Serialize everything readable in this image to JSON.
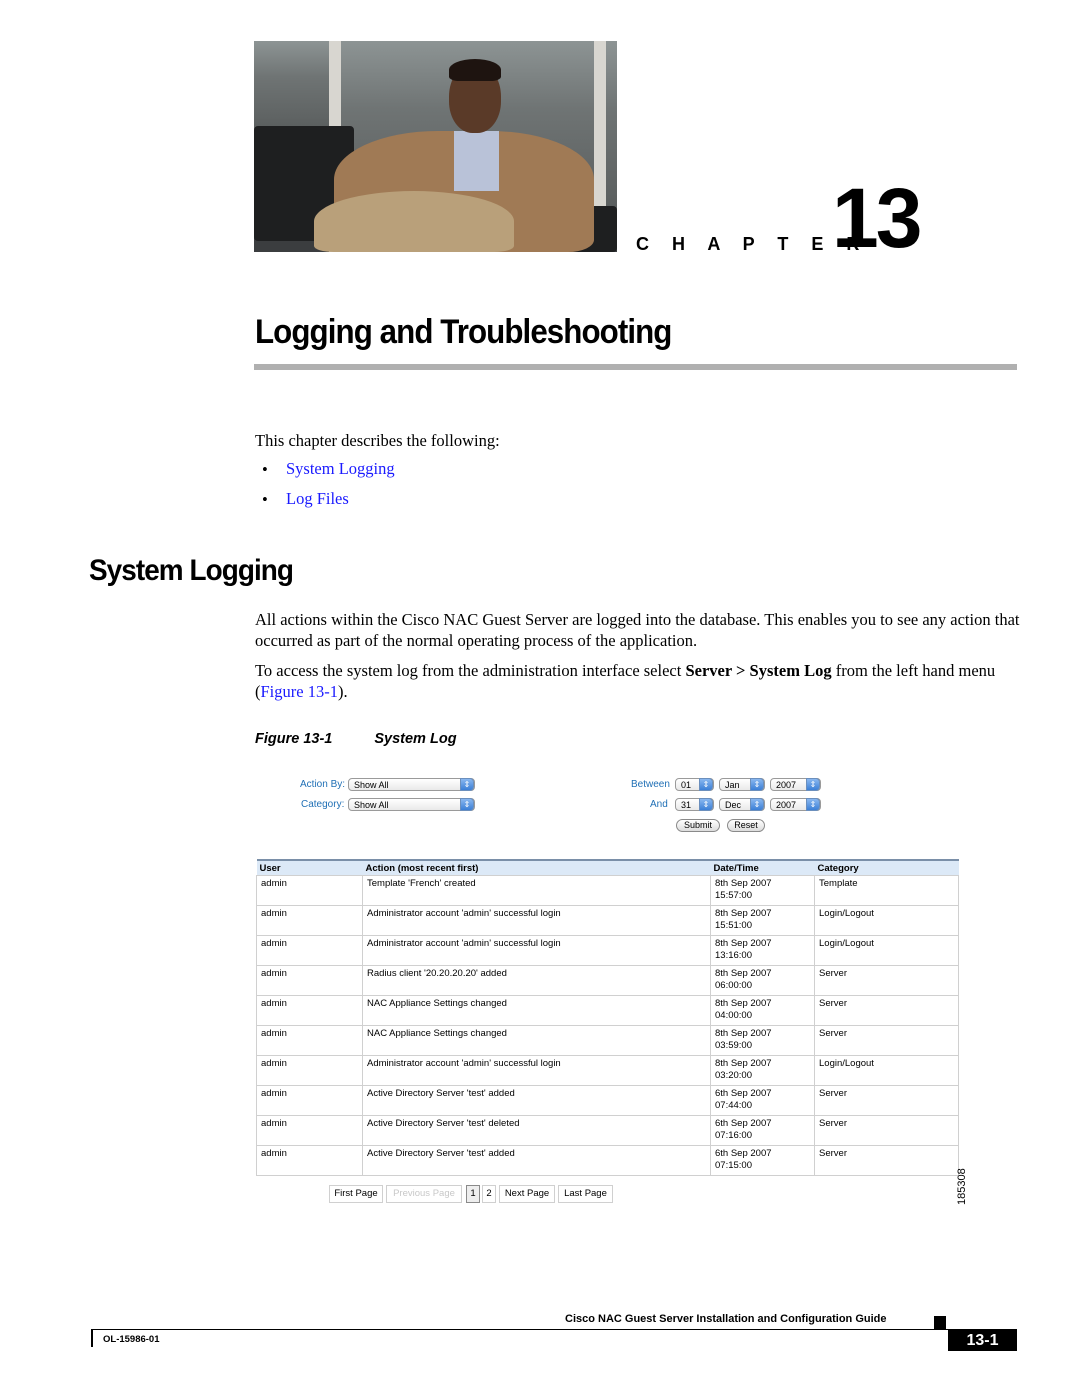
{
  "chapter": {
    "label": "C H A P T E R",
    "number": "13",
    "title": "Logging and Troubleshooting",
    "photo_alt": "man-seated-in-office"
  },
  "intro": {
    "text": "This chapter describes the following:",
    "bullets": [
      {
        "label": "System Logging"
      },
      {
        "label": "Log Files"
      }
    ],
    "bullet_glyph": "•"
  },
  "section": {
    "title": "System Logging",
    "para1": "All actions within the Cisco NAC Guest Server are logged into the database. This enables you to see any action that occurred as part of the normal operating process of the application.",
    "para2_pre": "To access the system log from the administration interface select ",
    "para2_bold": "Server > System Log",
    "para2_mid": " from the left hand menu (",
    "para2_link": "Figure 13-1",
    "para2_post": ")."
  },
  "figure": {
    "number": "Figure 13-1",
    "title": "System Log",
    "id": "185308",
    "filters": {
      "action_by_label": "Action By:",
      "action_by_value": "Show All",
      "category_label": "Category:",
      "category_value": "Show All",
      "between_label": "Between",
      "and_label": "And",
      "from_day": "01",
      "from_month": "Jan",
      "from_year": "2007",
      "to_day": "31",
      "to_month": "Dec",
      "to_year": "2007",
      "submit_label": "Submit",
      "reset_label": "Reset",
      "arrow_glyph": "⇕"
    },
    "table": {
      "headers": [
        "User",
        "Action (most recent first)",
        "Date/Time",
        "Category"
      ],
      "rows": [
        {
          "user": "admin",
          "action": "Template 'French' created",
          "date": "8th Sep 2007",
          "time": "15:57:00",
          "category": "Template"
        },
        {
          "user": "admin",
          "action": "Administrator account 'admin' successful login",
          "date": "8th Sep 2007",
          "time": "15:51:00",
          "category": "Login/Logout"
        },
        {
          "user": "admin",
          "action": "Administrator account 'admin' successful login",
          "date": "8th Sep 2007",
          "time": "13:16:00",
          "category": "Login/Logout"
        },
        {
          "user": "admin",
          "action": "Radius client '20.20.20.20' added",
          "date": "8th Sep 2007",
          "time": "06:00:00",
          "category": "Server"
        },
        {
          "user": "admin",
          "action": "NAC Appliance Settings changed",
          "date": "8th Sep 2007",
          "time": "04:00:00",
          "category": "Server"
        },
        {
          "user": "admin",
          "action": "NAC Appliance Settings changed",
          "date": "8th Sep 2007",
          "time": "03:59:00",
          "category": "Server"
        },
        {
          "user": "admin",
          "action": "Administrator account 'admin' successful login",
          "date": "8th Sep 2007",
          "time": "03:20:00",
          "category": "Login/Logout"
        },
        {
          "user": "admin",
          "action": "Active Directory Server 'test' added",
          "date": "6th Sep 2007",
          "time": "07:44:00",
          "category": "Server"
        },
        {
          "user": "admin",
          "action": "Active Directory Server 'test' deleted",
          "date": "6th Sep 2007",
          "time": "07:16:00",
          "category": "Server"
        },
        {
          "user": "admin",
          "action": "Active Directory Server 'test' added",
          "date": "6th Sep 2007",
          "time": "07:15:00",
          "category": "Server"
        }
      ]
    },
    "pagination": {
      "first": "First Page",
      "previous": "Previous Page",
      "pages": [
        "1",
        "2"
      ],
      "current_page": "1",
      "next": "Next Page",
      "last": "Last Page"
    }
  },
  "footer": {
    "guide_title": "Cisco NAC Guest Server Installation and Configuration Guide",
    "doc_number": "OL-15986-01",
    "page_number": "13-1"
  }
}
